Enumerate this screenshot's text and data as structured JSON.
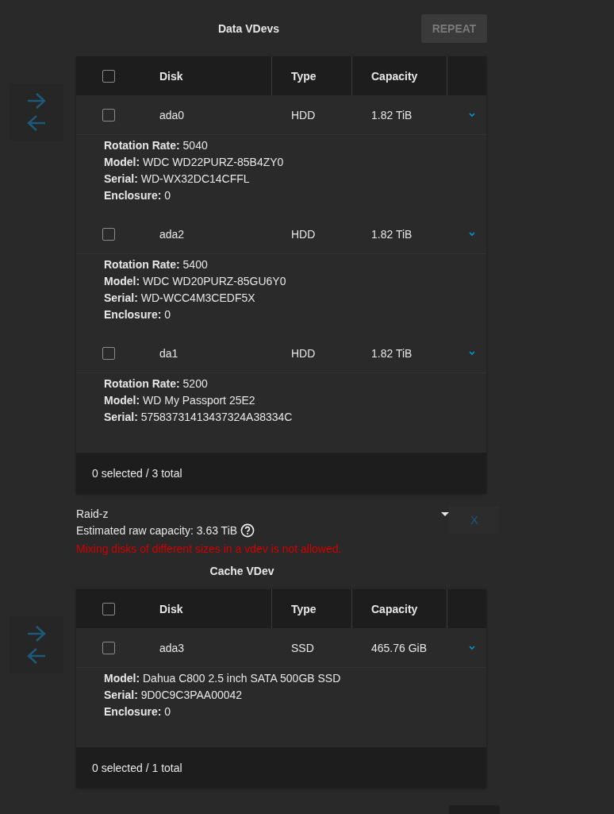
{
  "data_vdevs": {
    "title": "Data VDevs",
    "repeat_button": {
      "label": "REPEAT",
      "disabled": true
    },
    "table": {
      "columns": [
        "Disk",
        "Type",
        "Capacity"
      ],
      "select_all_checked": false,
      "rows": [
        {
          "checked": false,
          "disk": "ada0",
          "type": "HDD",
          "capacity": "1.82 TiB",
          "expanded": true,
          "details": [
            "**Rotation Rate:** 5040",
            "**Model:** WDC WD22PURZ-85B4ZY0",
            "**Serial:** WD-WX32DC14CFFL",
            "**Enclosure:** 0"
          ]
        },
        {
          "checked": false,
          "disk": "ada2",
          "type": "HDD",
          "capacity": "1.82 TiB",
          "expanded": true,
          "details": [
            "**Rotation Rate:** 5400",
            "**Model:** WDC WD20PURZ-85GU6Y0",
            "**Serial:** WD-WCC4M3CEDF5X",
            "**Enclosure:** 0"
          ]
        },
        {
          "checked": false,
          "disk": "da1",
          "type": "HDD",
          "capacity": "1.82 TiB",
          "expanded": true,
          "details": [
            "**Rotation Rate:** 5200",
            "**Model:** WD My Passport 25E2",
            "**Serial:** 57583731413437324A38334C"
          ]
        }
      ],
      "footer": "0 selected / 3 total"
    }
  },
  "vdev_config": {
    "layout": "Raid-z",
    "estimated_capacity": "Estimated raw capacity: 3.63 TiB",
    "error": "Mixing disks of different sizes in a vdev is not allowed.",
    "remove_button": "X"
  },
  "cache_vdev": {
    "title": "Cache VDev",
    "table": {
      "columns": [
        "Disk",
        "Type",
        "Capacity"
      ],
      "select_all_checked": false,
      "rows": [
        {
          "checked": false,
          "disk": "ada3",
          "type": "SSD",
          "capacity": "465.76 GiB",
          "expanded": true,
          "details": [
            "**Model:** Dahua C800 2.5 inch SATA 500GB SSD",
            "**Serial:** 9D0C9C3PAA00042",
            "**Enclosure:** 0"
          ]
        }
      ],
      "footer": "0 selected / 1 total"
    }
  }
}
